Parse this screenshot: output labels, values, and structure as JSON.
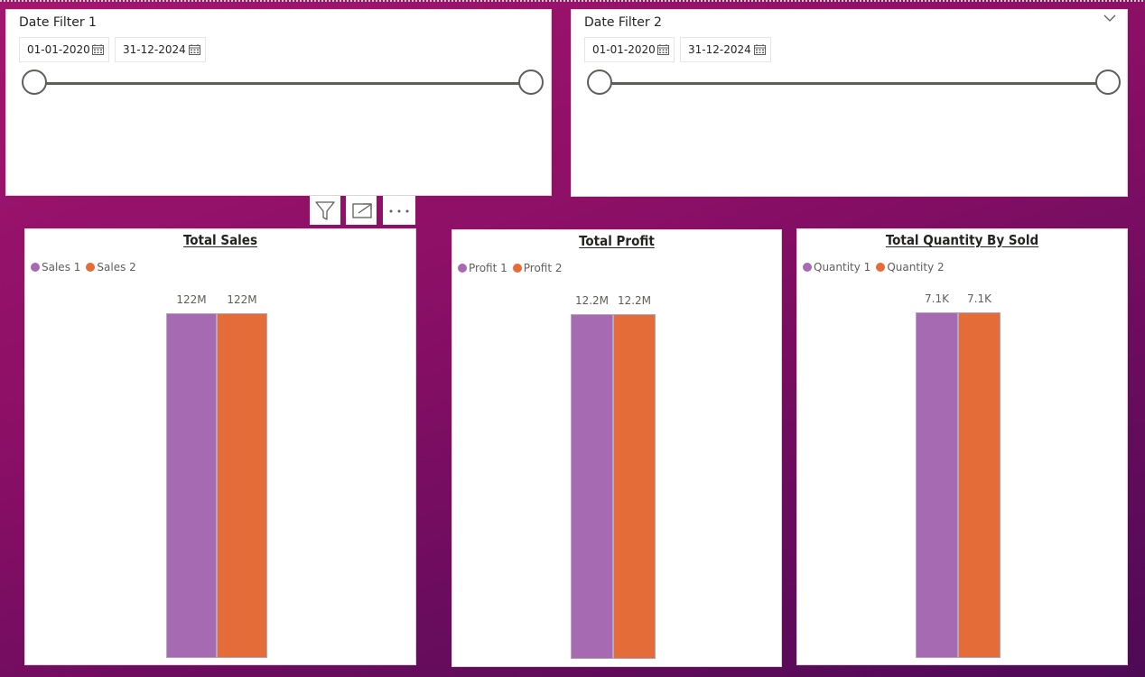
{
  "colors": {
    "series1": "#a66ab3",
    "series2": "#e46c38",
    "background": "#8c0f66"
  },
  "filters": [
    {
      "title": "Date Filter 1",
      "start": "01-01-2020",
      "end": "31-12-2024",
      "calendar_icon": "calendar-icon"
    },
    {
      "title": "Date Filter 2",
      "start": "01-01-2020",
      "end": "31-12-2024",
      "calendar_icon": "calendar-icon",
      "menu_icon": "chevron-down-icon"
    }
  ],
  "visual_toolbar": {
    "icons": [
      "filter-icon",
      "focus-mode-icon",
      "more-options-icon"
    ]
  },
  "charts": [
    {
      "title": "Total Sales",
      "legend": [
        "Sales 1",
        "Sales 2"
      ],
      "labels": [
        "122M",
        "122M"
      ]
    },
    {
      "title": "Total Profit",
      "legend": [
        "Profit 1",
        "Profit 2"
      ],
      "labels": [
        "12.2M",
        "12.2M"
      ]
    },
    {
      "title": "Total Quantity By Sold",
      "legend": [
        "Quantity 1",
        "Quantity 2"
      ],
      "labels": [
        "7.1K",
        "7.1K"
      ]
    }
  ],
  "chart_data": [
    {
      "type": "bar",
      "title": "Total Sales",
      "series": [
        {
          "name": "Sales 1",
          "values": [
            122000000
          ]
        },
        {
          "name": "Sales 2",
          "values": [
            122000000
          ]
        }
      ],
      "data_labels": [
        "122M",
        "122M"
      ],
      "legend": "top-left",
      "grid": false
    },
    {
      "type": "bar",
      "title": "Total Profit",
      "series": [
        {
          "name": "Profit 1",
          "values": [
            12200000
          ]
        },
        {
          "name": "Profit 2",
          "values": [
            12200000
          ]
        }
      ],
      "data_labels": [
        "12.2M",
        "12.2M"
      ],
      "legend": "top-left",
      "grid": false
    },
    {
      "type": "bar",
      "title": "Total Quantity By Sold",
      "series": [
        {
          "name": "Quantity 1",
          "values": [
            7100
          ]
        },
        {
          "name": "Quantity 2",
          "values": [
            7100
          ]
        }
      ],
      "data_labels": [
        "7.1K",
        "7.1K"
      ],
      "legend": "top-left",
      "grid": false
    }
  ]
}
